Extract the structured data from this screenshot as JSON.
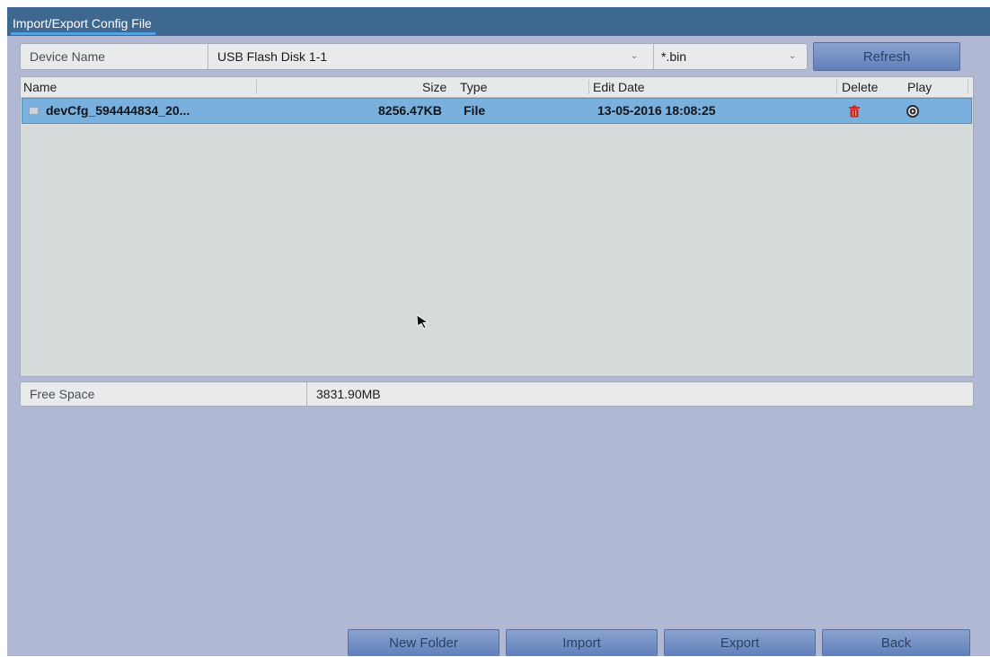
{
  "window": {
    "title": "Import/Export Config File"
  },
  "device": {
    "label": "Device Name",
    "selected": "USB Flash Disk 1-1",
    "filter": "*.bin",
    "refresh_label": "Refresh"
  },
  "table": {
    "columns": {
      "name": "Name",
      "size": "Size",
      "type": "Type",
      "edit_date": "Edit Date",
      "delete": "Delete",
      "play": "Play"
    },
    "rows": [
      {
        "name": "devCfg_594444834_20...",
        "size": "8256.47KB",
        "type": "File",
        "edit_date": "13-05-2016 18:08:25",
        "delete_icon": "trash-icon",
        "play_icon": "play-icon",
        "selected": true
      }
    ]
  },
  "free_space": {
    "label": "Free Space",
    "value": "3831.90MB"
  },
  "footer": {
    "new_folder_label": "New Folder",
    "import_label": "Import",
    "export_label": "Export",
    "back_label": "Back"
  },
  "colors": {
    "title_bar": "#3e6890",
    "background": "#b0b8d3",
    "selected_row": "#7ab0dd",
    "delete_icon": "#d0261e"
  }
}
